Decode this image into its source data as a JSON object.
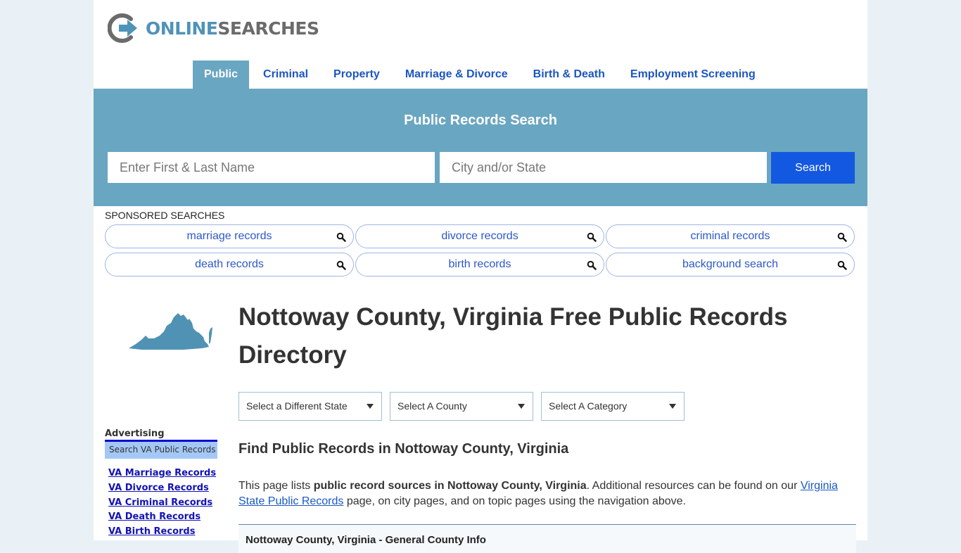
{
  "brand": {
    "online": "ONLINE",
    "searches": "SEARCHES",
    "primary_color": "#4f93b8",
    "secondary_color": "#6b6b6b"
  },
  "nav": {
    "items": [
      {
        "label": "Public",
        "active": true
      },
      {
        "label": "Criminal",
        "active": false
      },
      {
        "label": "Property",
        "active": false
      },
      {
        "label": "Marriage & Divorce",
        "active": false
      },
      {
        "label": "Birth & Death",
        "active": false
      },
      {
        "label": "Employment Screening",
        "active": false
      }
    ]
  },
  "hero": {
    "title": "Public Records Search",
    "name_placeholder": "Enter First & Last Name",
    "name_value": "",
    "city_placeholder": "City and/or State",
    "city_value": "",
    "search_label": "Search",
    "bg_color": "#69a6c1",
    "button_color": "#1358e0"
  },
  "sponsored": {
    "label": "SPONSORED SEARCHES",
    "items": [
      {
        "label": "marriage records",
        "icon": "search-icon"
      },
      {
        "label": "divorce records",
        "icon": "search-icon"
      },
      {
        "label": "criminal records",
        "icon": "search-icon"
      },
      {
        "label": "death records",
        "icon": "search-icon"
      },
      {
        "label": "birth records",
        "icon": "search-icon"
      },
      {
        "label": "background search",
        "icon": "search-icon"
      }
    ]
  },
  "sidebar": {
    "map_icon": "virginia-map-icon",
    "advertising_label": "Advertising",
    "box_title": "Search VA Public Records",
    "links": [
      "VA Marriage Records",
      "VA Divorce Records",
      "VA Criminal Records",
      "VA Death Records",
      "VA Birth Records"
    ]
  },
  "main": {
    "title": "Nottoway County, Virginia Free Public Records Directory",
    "selects": [
      {
        "value": "Select a Different State"
      },
      {
        "value": "Select A County"
      },
      {
        "value": "Select A Category"
      }
    ],
    "find_title": "Find Public Records in Nottoway County, Virginia",
    "intro": {
      "prefix": "This page lists ",
      "bold": "public record sources in Nottoway County, Virginia",
      "middle": ". Additional resources can be found on our ",
      "link": "Virginia State Public Records",
      "suffix": " page, on city pages, and on topic pages using the navigation above."
    },
    "info_box_title": "Nottoway County, Virginia - General County Info"
  }
}
